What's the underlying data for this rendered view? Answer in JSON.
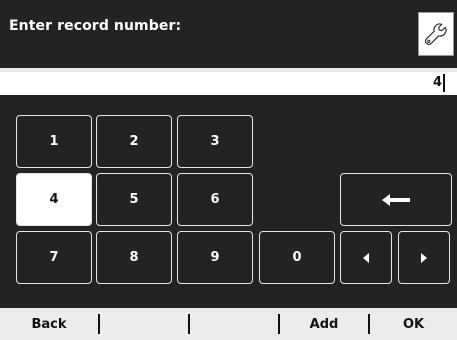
{
  "header": {
    "title": "Enter record number:",
    "settings_icon": "wrench-icon"
  },
  "entry": {
    "value": "4"
  },
  "keypad": {
    "keys": [
      "1",
      "2",
      "3",
      "4",
      "5",
      "6",
      "7",
      "8",
      "9",
      "0"
    ],
    "selected_key": "4",
    "backspace_icon": "arrow-left-icon",
    "left_icon": "triangle-left-icon",
    "right_icon": "triangle-right-icon"
  },
  "footer": {
    "softkeys": [
      "Back",
      "",
      "",
      "Add",
      "OK"
    ]
  },
  "colors": {
    "background": "#232323",
    "key_border": "#e6e6e6",
    "selected_key_background": "#ffffff",
    "footer_background": "#ececec"
  }
}
